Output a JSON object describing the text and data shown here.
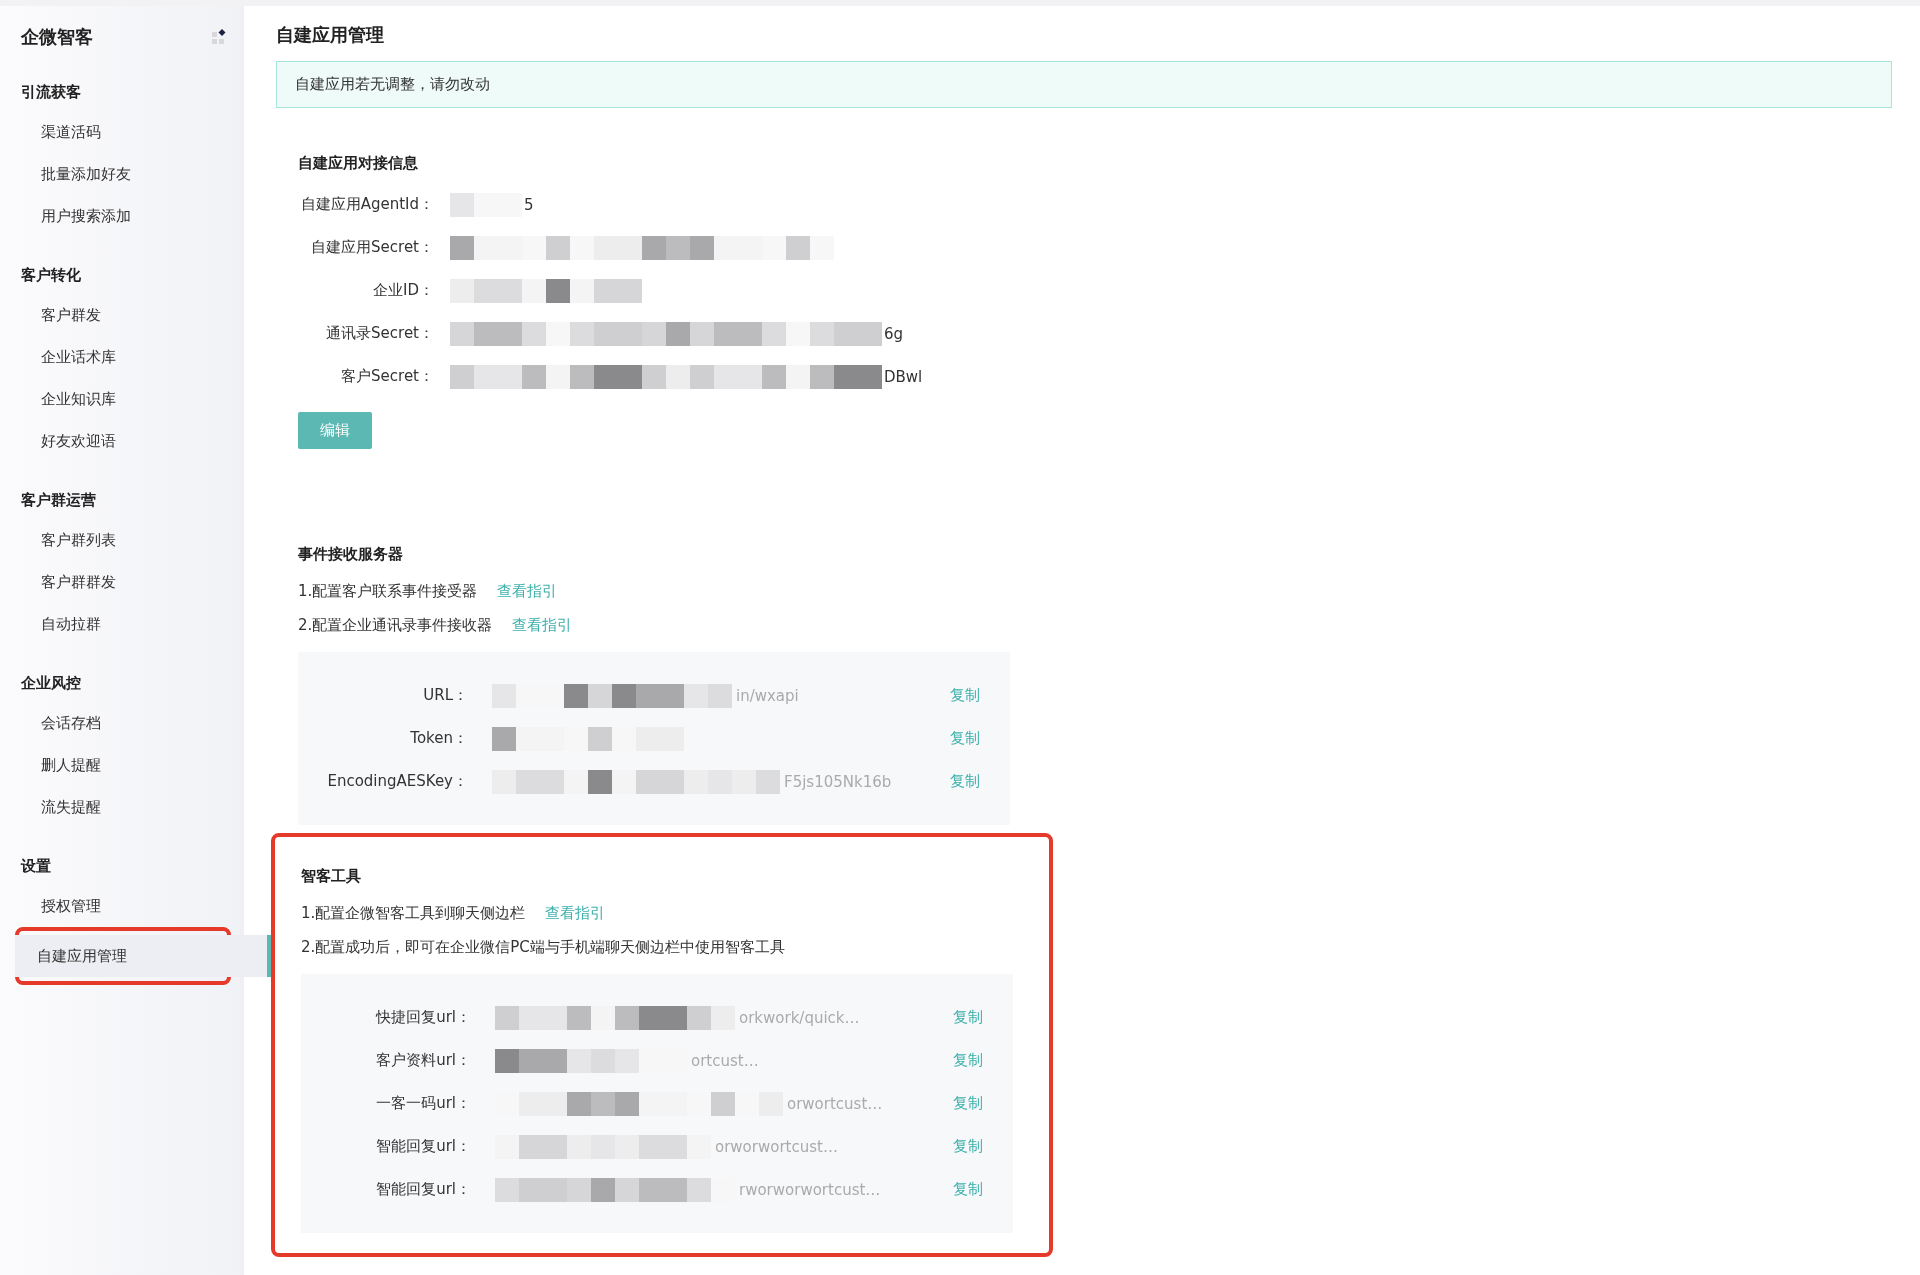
{
  "sidebar": {
    "brand": "企微智客",
    "groups": [
      {
        "title": "引流获客",
        "items": [
          {
            "label": "渠道活码",
            "selected": false
          },
          {
            "label": "批量添加好友",
            "selected": false
          },
          {
            "label": "用户搜索添加",
            "selected": false
          }
        ]
      },
      {
        "title": "客户转化",
        "items": [
          {
            "label": "客户群发",
            "selected": false
          },
          {
            "label": "企业话术库",
            "selected": false
          },
          {
            "label": "企业知识库",
            "selected": false
          },
          {
            "label": "好友欢迎语",
            "selected": false
          }
        ]
      },
      {
        "title": "客户群运营",
        "items": [
          {
            "label": "客户群列表",
            "selected": false
          },
          {
            "label": "客户群群发",
            "selected": false
          },
          {
            "label": "自动拉群",
            "selected": false
          }
        ]
      },
      {
        "title": "企业风控",
        "items": [
          {
            "label": "会话存档",
            "selected": false
          },
          {
            "label": "删人提醒",
            "selected": false
          },
          {
            "label": "流失提醒",
            "selected": false
          }
        ]
      },
      {
        "title": "设置",
        "items": [
          {
            "label": "授权管理",
            "selected": false
          },
          {
            "label": "自建应用管理",
            "selected": true,
            "highlighted": true
          }
        ]
      }
    ]
  },
  "page": {
    "title": "自建应用管理",
    "notice": "自建应用若无调整，请勿改动",
    "credentials": {
      "title": "自建应用对接信息",
      "fields": [
        {
          "label": "自建应用AgentId：",
          "value": "5",
          "masked": true
        },
        {
          "label": "自建应用Secret：",
          "masked": true
        },
        {
          "label": "企业ID：",
          "masked": true
        },
        {
          "label": "通讯录Secret：",
          "value": "6g",
          "masked": true
        },
        {
          "label": "客户Secret：",
          "value": "DBwl",
          "masked": true
        }
      ],
      "button": "编辑"
    },
    "sections": [
      {
        "title": "事件接收服务器",
        "steps": [
          {
            "text": "1.配置客户联系事件接受器",
            "link": "查看指引"
          },
          {
            "text": "2.配置企业通讯录事件接收器",
            "link": "查看指引"
          }
        ],
        "rows": [
          {
            "label": "URL：",
            "value": "in/wxapi",
            "masked": true,
            "action": "复制"
          },
          {
            "label": "Token：",
            "masked": true,
            "action": "复制"
          },
          {
            "label": "EncodingAESKey：",
            "value": "F5js105Nk16b",
            "masked": true,
            "action": "复制"
          }
        ]
      },
      {
        "title": "智客工具",
        "highlighted": true,
        "steps": [
          {
            "text": "1.配置企微智客工具到聊天侧边栏",
            "link": "查看指引"
          },
          {
            "text": "2.配置成功后，即可在企业微信PC端与手机端聊天侧边栏中使用智客工具"
          }
        ],
        "rows": [
          {
            "label": "快捷回复url：",
            "value": "orkwork/quick…",
            "masked": true,
            "action": "复制"
          },
          {
            "label": "客户资料url：",
            "value": "ortcust…",
            "masked": true,
            "action": "复制"
          },
          {
            "label": "一客一码url：",
            "value": "orwortcust…",
            "masked": true,
            "action": "复制"
          },
          {
            "label": "智能回复url：",
            "value": "orworwortcust…",
            "masked": true,
            "action": "复制"
          },
          {
            "label": "智能回复url：",
            "value": "rworworwortcust…",
            "masked": true,
            "action": "复制"
          }
        ]
      }
    ]
  }
}
